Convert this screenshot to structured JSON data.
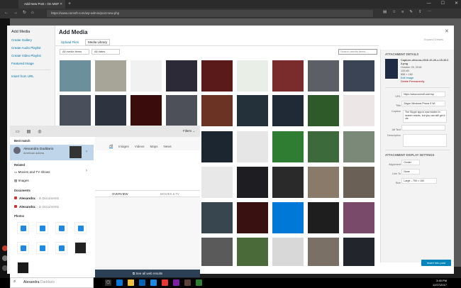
{
  "browser": {
    "tab_title": "Add New Post ‹ On MSF",
    "url": "https://www.onmsft.com/wp-admin/post-new.php"
  },
  "sidebar": {
    "title": "Add Media",
    "items": [
      "Create Gallery",
      "Create Audio Playlist",
      "Create Video Playlist",
      "Featured Image"
    ],
    "insert_url": "Insert from URL"
  },
  "modal": {
    "title": "Add Media",
    "tabs": [
      "Upload Files",
      "Media Library"
    ],
    "filter1": "All media items",
    "filter2": "All dates",
    "search_placeholder": "Search media items...",
    "expand": "Expand Details"
  },
  "details": {
    "heading": "ATTACHMENT DETAILS",
    "filename": "Capture-ofesora-2016-10-26-x-15.40.03.png",
    "date": "October 25, 2016",
    "size": "133 kB",
    "dims": "858 × 182",
    "edit": "Edit Image",
    "delete": "Delete Permanently",
    "url_label": "URL",
    "url": "https://www.onmsft.com/wp",
    "title_label": "Title",
    "title": "Skype Windows Phone 8 Wi",
    "caption_label": "Caption",
    "caption": "The Skype app is now hidden in search results, but you can still get it via",
    "alt_label": "Alt Text",
    "desc_label": "Description",
    "display_heading": "ATTACHMENT DISPLAY SETTINGS",
    "align_label": "Alignment",
    "align": "Center",
    "link_label": "Link To",
    "link": "None",
    "size_label": "Size",
    "size_opt": "Large – 750 × 160",
    "insert": "Insert into post"
  },
  "search": {
    "filters": "Filters",
    "best_match": "Best match",
    "person_name": "Alexandra Daddario",
    "person_sub": "American actress",
    "related": "Related",
    "related_items": [
      "Movies and TV shows",
      "Images"
    ],
    "docs_heading": "Documents",
    "docs": [
      {
        "name": "Alexandra:",
        "loc": "- in Documents"
      },
      {
        "name": "Alexandra:",
        "loc": "- in Documents"
      }
    ],
    "photos_heading": "Photos",
    "tabs": [
      "All",
      "Images",
      "Videos",
      "Maps",
      "News"
    ],
    "overview": "OVERVIEW",
    "movies_tv": "MOVIES & TV",
    "see_all": "See all web results",
    "query": "Alexandra",
    "query_suggest": " Daddario"
  },
  "taskbar": {
    "time": "3:45 PM",
    "date": "12/27/2017"
  },
  "colors": {
    "accent": "#0073aa",
    "best_match_bg": "#bfd6ea",
    "taskbar": "#000000",
    "insert_button": "#0085ba"
  }
}
